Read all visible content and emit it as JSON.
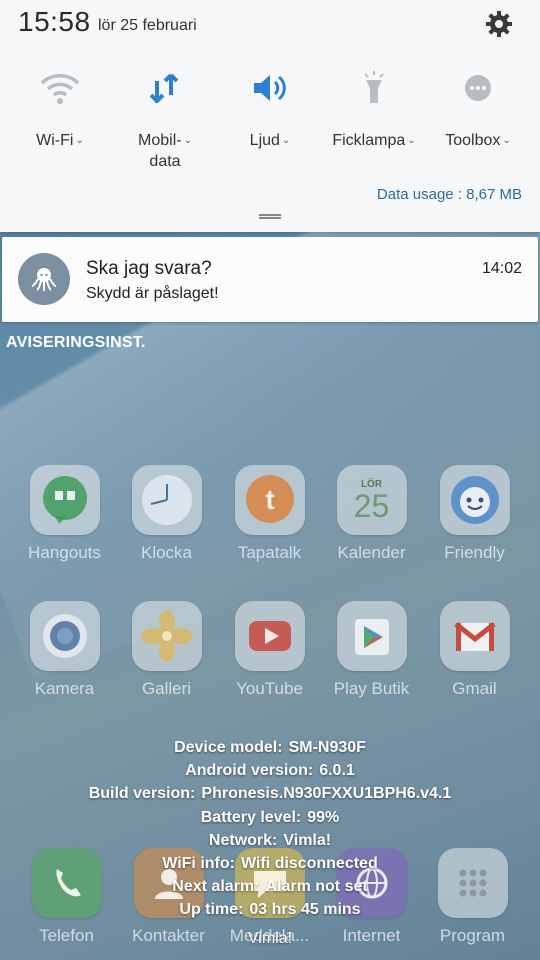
{
  "status": {
    "time": "15:58",
    "date": "lör 25 februari"
  },
  "quick_settings": [
    {
      "label": "Wi-Fi",
      "icon": "wifi-icon"
    },
    {
      "label_line1": "Mobil-",
      "label_line2": "data",
      "icon": "mobile-data-icon",
      "color": "#2f7fd0"
    },
    {
      "label": "Ljud",
      "icon": "sound-icon",
      "color": "#2f7fd0"
    },
    {
      "label": "Ficklampa",
      "icon": "flashlight-icon"
    },
    {
      "label": "Toolbox",
      "icon": "toolbox-icon"
    }
  ],
  "data_usage": "Data usage : 8,67 MB",
  "notification": {
    "title": "Ska jag svara?",
    "body": "Skydd är påslaget!",
    "time": "14:02",
    "icon": "octopus-icon"
  },
  "notification_settings_label": "AVISERINGSINST.",
  "apps": [
    {
      "label": "Hangouts",
      "icon": "hangouts-icon"
    },
    {
      "label": "Klocka",
      "icon": "clock-icon"
    },
    {
      "label": "Tapatalk",
      "icon": "tapatalk-icon"
    },
    {
      "label": "Kalender",
      "icon": "calendar-icon",
      "day_name": "LÖR",
      "day_number": "25"
    },
    {
      "label": "Friendly",
      "icon": "friendly-icon"
    },
    {
      "label": "Kamera",
      "icon": "camera-icon"
    },
    {
      "label": "Galleri",
      "icon": "gallery-icon"
    },
    {
      "label": "YouTube",
      "icon": "youtube-icon"
    },
    {
      "label": "Play Butik",
      "icon": "play-store-icon"
    },
    {
      "label": "Gmail",
      "icon": "gmail-icon"
    },
    {
      "label": "Telefon",
      "icon": "phone-icon"
    },
    {
      "label": "Kontakter",
      "icon": "contacts-icon"
    },
    {
      "label": "Meddela...",
      "icon": "messages-icon"
    },
    {
      "label": "Internet",
      "icon": "internet-icon"
    },
    {
      "label": "Program",
      "icon": "apps-icon"
    }
  ],
  "device_info": [
    {
      "key": "Device model:",
      "value": "SM-N930F"
    },
    {
      "key": "Android version:",
      "value": "6.0.1"
    },
    {
      "key": "Build version:",
      "value": "Phronesis.N930FXXU1BPH6.v4.1"
    },
    {
      "key": "Battery level:",
      "value": "99%"
    },
    {
      "key": "Network:",
      "value": "Vimla!"
    },
    {
      "key": "WiFi info:",
      "value": "Wifi disconnected"
    },
    {
      "key": "Next alarm:",
      "value": "Alarm not set"
    },
    {
      "key": "Up time:",
      "value": "03 hrs 45 mins"
    }
  ],
  "carrier": "Vimla!"
}
